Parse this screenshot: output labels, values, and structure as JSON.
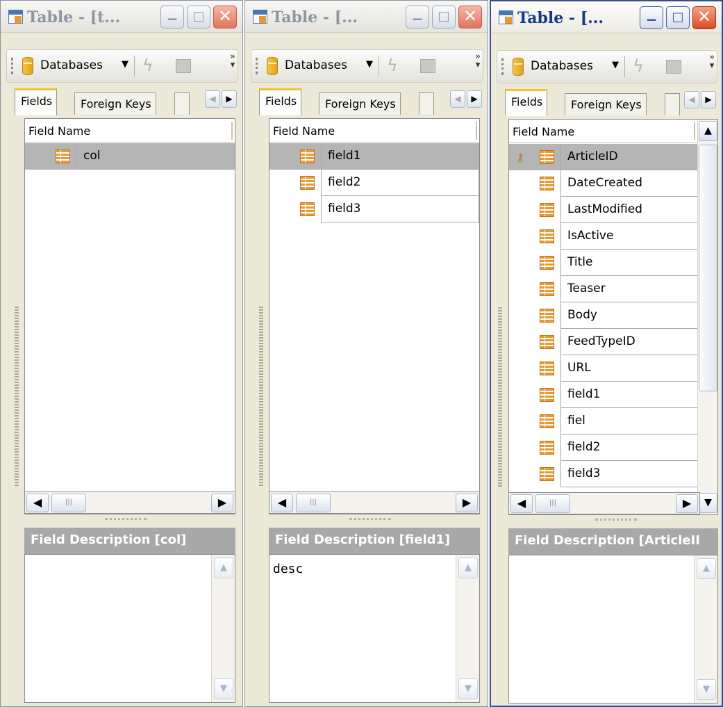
{
  "windows": [
    {
      "title": "Table - [t...",
      "active": false,
      "toolbar": {
        "databases_label": "Databases"
      },
      "tabs": {
        "fields": "Fields",
        "foreign_keys": "Foreign Keys"
      },
      "grid": {
        "header": "Field Name",
        "rows": [
          {
            "name": "col",
            "key": false,
            "selected": true
          }
        ]
      },
      "description": {
        "header": "Field Description [col]",
        "text": ""
      }
    },
    {
      "title": "Table - [...",
      "active": false,
      "toolbar": {
        "databases_label": "Databases"
      },
      "tabs": {
        "fields": "Fields",
        "foreign_keys": "Foreign Keys"
      },
      "grid": {
        "header": "Field Name",
        "rows": [
          {
            "name": "field1",
            "key": false,
            "selected": true
          },
          {
            "name": "field2",
            "key": false,
            "selected": false
          },
          {
            "name": "field3",
            "key": false,
            "selected": false
          }
        ]
      },
      "description": {
        "header": "Field Description [field1]",
        "text": "desc"
      }
    },
    {
      "title": "Table - [...",
      "active": true,
      "toolbar": {
        "databases_label": "Databases"
      },
      "tabs": {
        "fields": "Fields",
        "foreign_keys": "Foreign Keys"
      },
      "grid": {
        "header": "Field Name",
        "rows": [
          {
            "name": "ArticleID",
            "key": true,
            "selected": true
          },
          {
            "name": "DateCreated",
            "key": false,
            "selected": false
          },
          {
            "name": "LastModified",
            "key": false,
            "selected": false
          },
          {
            "name": "IsActive",
            "key": false,
            "selected": false
          },
          {
            "name": "Title",
            "key": false,
            "selected": false
          },
          {
            "name": "Teaser",
            "key": false,
            "selected": false
          },
          {
            "name": "Body",
            "key": false,
            "selected": false
          },
          {
            "name": "FeedTypeID",
            "key": false,
            "selected": false
          },
          {
            "name": "URL",
            "key": false,
            "selected": false
          },
          {
            "name": "field1",
            "key": false,
            "selected": false
          },
          {
            "name": "fiel",
            "key": false,
            "selected": false
          },
          {
            "name": "field2",
            "key": false,
            "selected": false
          },
          {
            "name": "field3",
            "key": false,
            "selected": false
          }
        ]
      },
      "description": {
        "header": "Field Description [ArticleII",
        "text": ""
      }
    }
  ],
  "colors": {
    "selected_row": "#b5b5b5",
    "field_icon": "#e79a33",
    "active_title": "#123a8b",
    "inactive_title": "#8e95a3",
    "close_button": "#de4b25"
  },
  "icons": [
    "table-icon",
    "minimize-icon",
    "maximize-icon",
    "close-icon",
    "database-icon",
    "lightning-icon",
    "disk-icon",
    "field-icon",
    "primary-key-icon"
  ]
}
